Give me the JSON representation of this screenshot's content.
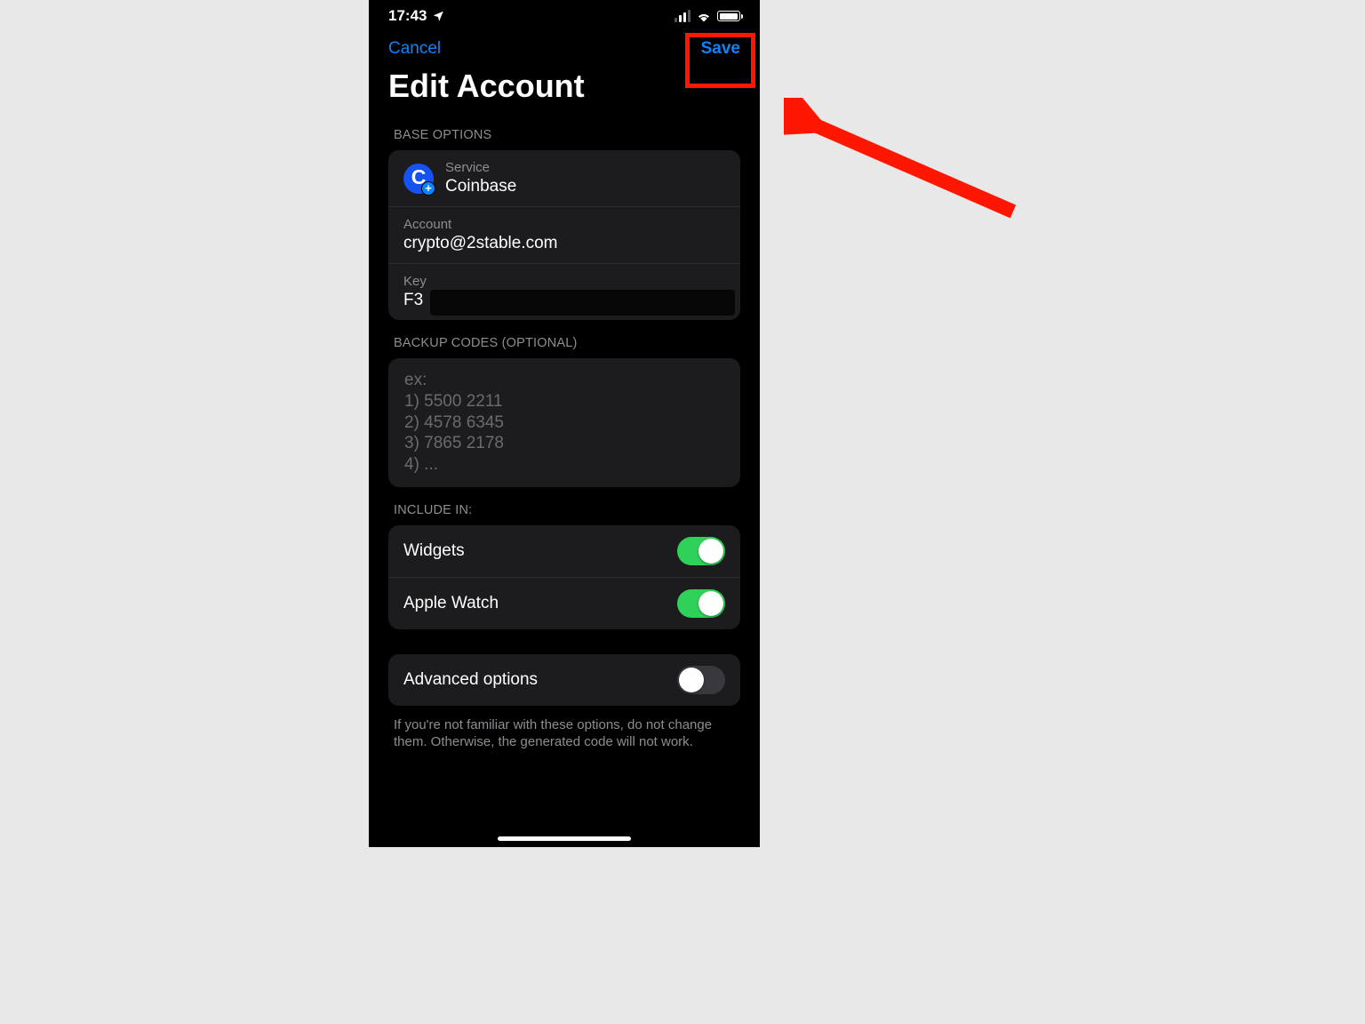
{
  "status": {
    "time": "17:43"
  },
  "nav": {
    "cancel": "Cancel",
    "save": "Save"
  },
  "title": "Edit Account",
  "sections": {
    "base": {
      "header": "BASE OPTIONS",
      "service_label": "Service",
      "service_value": "Coinbase",
      "account_label": "Account",
      "account_value": "crypto@2stable.com",
      "key_label": "Key",
      "key_value": "F3"
    },
    "backup": {
      "header": "BACKUP CODES (OPTIONAL)",
      "placeholder": "ex:\n1) 5500 2211\n2) 4578 6345\n3) 7865 2178\n4) ..."
    },
    "include": {
      "header": "INCLUDE IN:",
      "widgets_label": "Widgets",
      "applewatch_label": "Apple Watch"
    },
    "advanced": {
      "label": "Advanced options",
      "footer": "If you're not familiar with these options, do not change them. Otherwise, the generated code will not work."
    }
  },
  "colors": {
    "accent": "#0a84ff",
    "highlight": "#ff1600",
    "toggle_on": "#30d158"
  }
}
